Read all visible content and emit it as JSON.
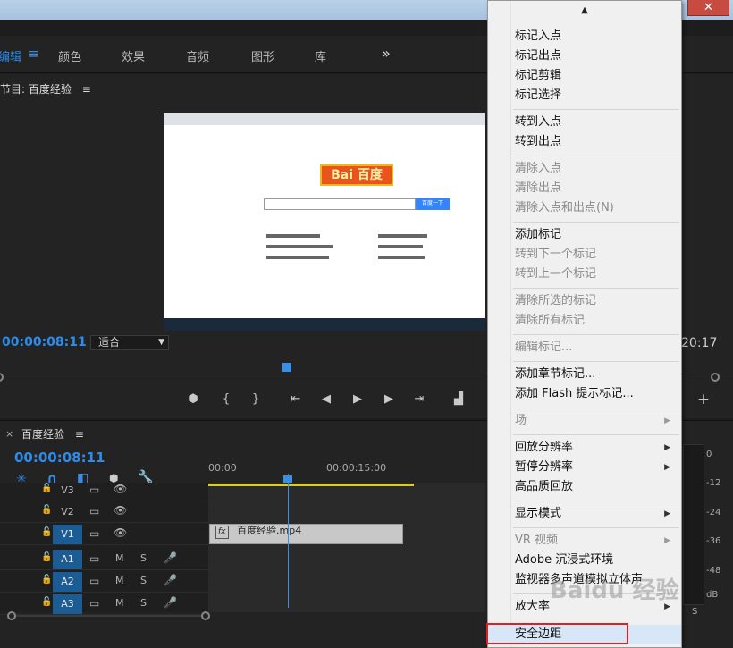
{
  "workspace": {
    "tabs": [
      "编辑",
      "颜色",
      "效果",
      "音频",
      "图形",
      "库"
    ],
    "more": "»"
  },
  "program_monitor": {
    "title": "节目: 百度经验",
    "timecode_in": "00:00:08:11",
    "fit": "适合",
    "timecode_end_partial": "20:17"
  },
  "video": {
    "logo_text": "Bai 百度",
    "search_button": "百度一下"
  },
  "timeline": {
    "sequence_name": "百度经验",
    "timecode": "00:00:08:11",
    "ruler": [
      "00:00",
      "00:00:15:00"
    ],
    "tracks": [
      {
        "id": "V3",
        "active": false
      },
      {
        "id": "V2",
        "active": false
      },
      {
        "id": "V1",
        "active": true
      },
      {
        "id": "A1",
        "active": true
      },
      {
        "id": "A2",
        "active": true
      },
      {
        "id": "A3",
        "active": true
      }
    ],
    "clip_label": "百度经验.mp4",
    "fx": "fx",
    "mute": "M",
    "solo": "S"
  },
  "meters": {
    "labels": [
      "0",
      "-12",
      "-24",
      "-36",
      "-48",
      "dB"
    ],
    "bottom": "S"
  },
  "context_menu": {
    "scroll_up": "▲",
    "items": [
      {
        "label": "标记入点",
        "disabled": false
      },
      {
        "label": "标记出点",
        "disabled": false
      },
      {
        "label": "标记剪辑",
        "disabled": false
      },
      {
        "label": "标记选择",
        "disabled": false
      },
      {
        "label": "转到入点",
        "disabled": false
      },
      {
        "label": "转到出点",
        "disabled": false
      },
      {
        "label": "清除入点",
        "disabled": true
      },
      {
        "label": "清除出点",
        "disabled": true
      },
      {
        "label": "清除入点和出点(N)",
        "disabled": true
      },
      {
        "label": "添加标记",
        "disabled": false
      },
      {
        "label": "转到下一个标记",
        "disabled": true
      },
      {
        "label": "转到上一个标记",
        "disabled": true
      },
      {
        "label": "清除所选的标记",
        "disabled": true
      },
      {
        "label": "清除所有标记",
        "disabled": true
      },
      {
        "label": "编辑标记...",
        "disabled": true
      },
      {
        "label": "添加章节标记...",
        "disabled": false
      },
      {
        "label": "添加 Flash 提示标记...",
        "disabled": false
      },
      {
        "label": "场",
        "disabled": true,
        "submenu": true
      },
      {
        "label": "回放分辨率",
        "disabled": false,
        "submenu": true
      },
      {
        "label": "暂停分辨率",
        "disabled": false,
        "submenu": true
      },
      {
        "label": "高品质回放",
        "disabled": false
      },
      {
        "label": "显示模式",
        "disabled": false,
        "submenu": true
      },
      {
        "label": "VR 视频",
        "disabled": true,
        "submenu": true
      },
      {
        "label": "Adobe 沉浸式环境",
        "disabled": false
      },
      {
        "label": "监视器多声道模拟立体声",
        "disabled": false
      },
      {
        "label": "放大率",
        "disabled": false,
        "submenu": true
      },
      {
        "label": "安全边距",
        "disabled": false,
        "highlighted": true
      }
    ],
    "submenu_arrow": "▶"
  },
  "window": {
    "close": "✕"
  },
  "watermark": "Baidu 经验"
}
